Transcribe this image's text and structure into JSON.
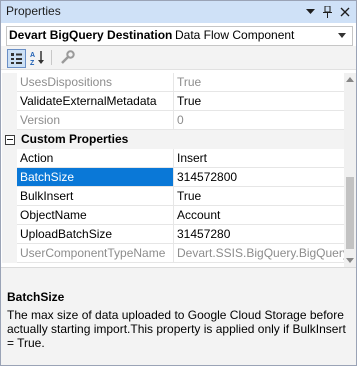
{
  "window": {
    "title": "Properties"
  },
  "object_selector": {
    "name": "Devart BigQuery Destination",
    "type": "Data Flow Component"
  },
  "toolbar": {
    "buttons": [
      {
        "icon": "categorized-icon"
      },
      {
        "icon": "alphabetical-icon"
      },
      {
        "icon": "property-pages-icon"
      }
    ]
  },
  "grid": {
    "rows_before": [
      {
        "name": "UsesDispositions",
        "value": "True",
        "dim": true
      },
      {
        "name": "ValidateExternalMetadata",
        "value": "True",
        "dim": false
      },
      {
        "name": "Version",
        "value": "0",
        "dim": true
      }
    ],
    "category": "Custom Properties",
    "rows": [
      {
        "name": "Action",
        "value": "Insert",
        "dim": false,
        "selected": false
      },
      {
        "name": "BatchSize",
        "value": "314572800",
        "dim": false,
        "selected": true
      },
      {
        "name": "BulkInsert",
        "value": "True",
        "dim": false,
        "selected": false
      },
      {
        "name": "ObjectName",
        "value": "Account",
        "dim": false,
        "selected": false
      },
      {
        "name": "UploadBatchSize",
        "value": "31457280",
        "dim": false,
        "selected": false
      },
      {
        "name": "UserComponentTypeName",
        "value": "Devart.SSIS.BigQuery.BigQuery",
        "dim": true,
        "selected": false
      }
    ]
  },
  "description": {
    "title": "BatchSize",
    "text": "The max size of data uploaded to Google Cloud Storage before actually starting import.This property is applied only if BulkInsert = True."
  },
  "colors": {
    "selection": "#0a78d7",
    "titlebar": "#cfe1f7"
  }
}
